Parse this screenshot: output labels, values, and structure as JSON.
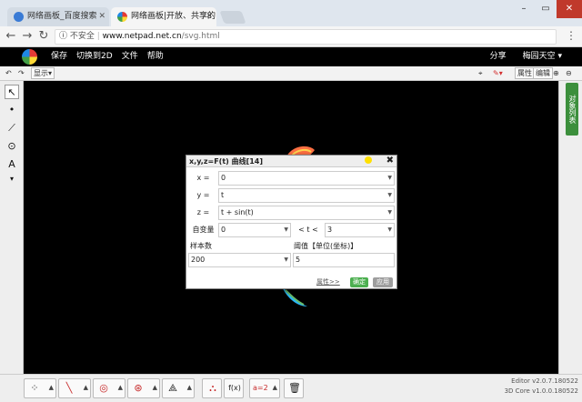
{
  "browser": {
    "tabs": [
      {
        "title": "网络画板_百度搜索",
        "active": false
      },
      {
        "title": "网络画板|开放、共享的",
        "active": true
      }
    ],
    "address": {
      "security": "不安全",
      "domain": "www.netpad.net.cn",
      "path": "/svg.html"
    }
  },
  "app": {
    "menu": [
      "保存",
      "切换到2D",
      "文件",
      "帮助"
    ],
    "right": [
      "分享",
      "梅园天空"
    ],
    "toolbar": {
      "display_label": "显示",
      "property_label": "属性",
      "edit_label": "编辑"
    }
  },
  "side_tab": {
    "label": "对象列表"
  },
  "dialog": {
    "title": "x,y,z=F(t) 曲线[14]",
    "x_label": "x =",
    "x_value": "0",
    "y_label": "y =",
    "y_value": "t",
    "z_label": "z =",
    "z_value": "t + sin(t)",
    "var_label": "自变量",
    "var_min": "0",
    "var_mid": "< t <",
    "var_max": "3",
    "samples_label": "样本数",
    "samples_value": "200",
    "threshold_label": "阈值【单位(坐标)】",
    "threshold_value": "5",
    "properties_link": "属性>>",
    "ok": "确定",
    "apply": "应用"
  },
  "version": {
    "editor": "Editor v2.0.7.180522",
    "core": "3D Core v1.0.0.180522"
  },
  "colors": {
    "app_bg": "#000000",
    "ok_green": "#4caf50",
    "side_tab": "#3c8f3c"
  }
}
